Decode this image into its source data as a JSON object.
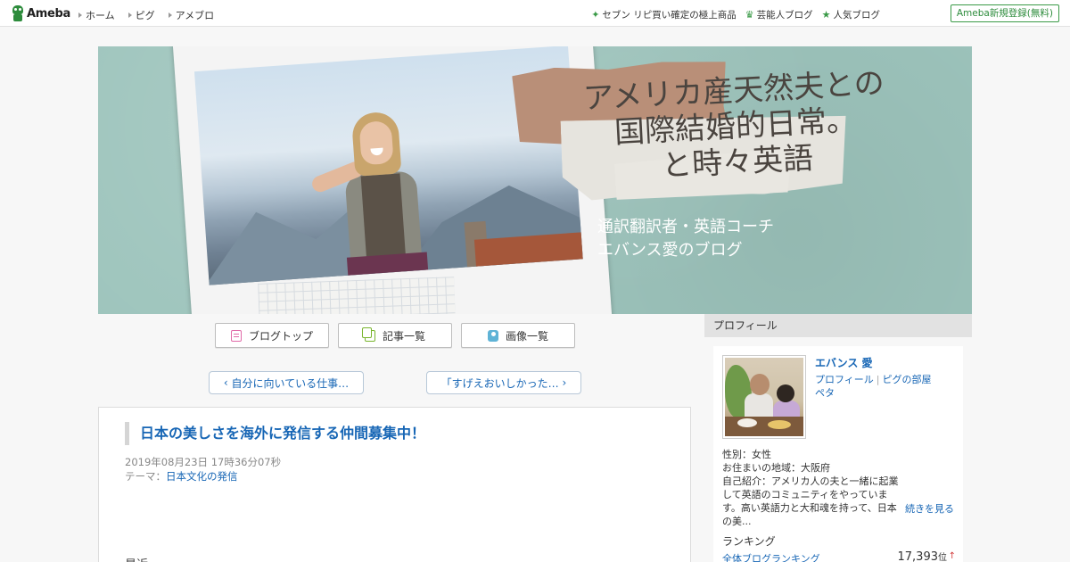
{
  "topbar": {
    "logo_text": "Ameba",
    "nav": [
      {
        "label": "ホーム"
      },
      {
        "label": "ピグ"
      },
      {
        "label": "アメブロ"
      }
    ],
    "right_links": [
      {
        "icon": "sparkle-icon",
        "label": "セブン リピ買い確定の極上商品"
      },
      {
        "icon": "crown-icon",
        "label": "芸能人ブログ"
      },
      {
        "icon": "star-icon",
        "label": "人気ブログ"
      }
    ],
    "register_label": "Ameba新規登録(無料)"
  },
  "banner": {
    "title_lines": [
      "アメリカ産天然夫との",
      "国際結婚的日常。",
      "と時々英語"
    ],
    "subtitle_lines": [
      "通訳翻訳者・英語コーチ",
      "エバンス愛のブログ"
    ]
  },
  "tabs": [
    {
      "label": "ブログトップ",
      "icon": "blog-top-icon"
    },
    {
      "label": "記事一覧",
      "icon": "article-list-icon"
    },
    {
      "label": "画像一覧",
      "icon": "camera-icon"
    }
  ],
  "pager": {
    "prev_label": "自分に向いている仕事…",
    "next_label": "「すげえおいしかった…"
  },
  "article": {
    "title": "日本の美しさを海外に発信する仲間募集中！",
    "date": "2019年08月23日 17時36分07秒",
    "theme_label": "テーマ：",
    "theme": "日本文化の発信",
    "body_start": "最近"
  },
  "sidebar": {
    "header": "プロフィール",
    "name": "エバンス 愛",
    "links": [
      "プロフィール",
      "ピグの部屋",
      "ペタ"
    ],
    "info": {
      "gender": "性別：女性",
      "residence": "お住まいの地域：大阪府",
      "intro": "自己紹介：アメリカ人の夫と一緒に起業して英語のコミュニティをやっています。高い英語力と大和魂を持って、日本の美..."
    },
    "more_label": "続きを見る",
    "ranking": {
      "title": "ランキング",
      "label": "全体ブログランキング",
      "value": "17,393",
      "unit": "位",
      "trend": "↑"
    }
  },
  "colors": {
    "accent_green": "#2d8c3c",
    "link_blue": "#1766b5",
    "banner_teal": "#9dc4bc"
  }
}
